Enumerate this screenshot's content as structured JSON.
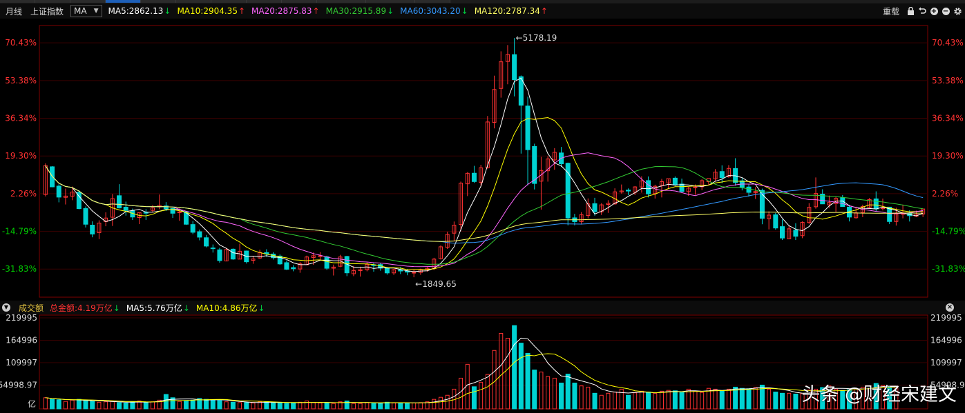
{
  "toolbar": {
    "period": "月线",
    "index_name": "上证指数",
    "indicator": "MA",
    "ma_items": [
      {
        "label": "MA5:2862.13",
        "dir": "down",
        "color": "#ffffff"
      },
      {
        "label": "MA10:2904.35",
        "dir": "up",
        "color": "#ffff00"
      },
      {
        "label": "MA20:2875.83",
        "dir": "up",
        "color": "#ff66ff"
      },
      {
        "label": "MA30:2915.89",
        "dir": "down",
        "color": "#33cc33"
      },
      {
        "label": "MA60:3043.20",
        "dir": "down",
        "color": "#3399ff"
      },
      {
        "label": "MA120:2787.34",
        "dir": "up",
        "color": "#ffff66"
      }
    ],
    "reload_label": "重载"
  },
  "volume_bar": {
    "title": "成交额",
    "total": "总金额:4.19万亿",
    "total_dir": "down",
    "ma5": "MA5:5.76万亿",
    "ma5_dir": "down",
    "ma10": "MA10:4.86万亿",
    "ma10_dir": "down"
  },
  "watermark": "头条 @财经宋建文",
  "colors": {
    "up": "#ff3232",
    "down": "#00d2d2",
    "grid": "#3a0000",
    "axis": "#800000",
    "pos_label": "#ff3232",
    "neg_label": "#00cc00"
  },
  "chart_data": [
    {
      "type": "candlestick",
      "y_axis_percent_labels": [
        "70.43%",
        "53.38%",
        "36.34%",
        "19.30%",
        "2.26%",
        "-14.79%",
        "-31.83%"
      ],
      "annotations": [
        {
          "text": "←5178.19",
          "target": "max"
        },
        {
          "text": "←1849.65",
          "target": "min"
        }
      ],
      "base_price": 3000,
      "ylim": [
        1664,
        5348
      ],
      "ohlc": [
        [
          3056,
          3478,
          3030,
          3447
        ],
        [
          3432,
          3441,
          3154,
          3160
        ],
        [
          3170,
          3195,
          2950,
          3021
        ],
        [
          3018,
          3137,
          2921,
          3035
        ],
        [
          3034,
          3164,
          2979,
          3090
        ],
        [
          3087,
          3115,
          2855,
          2865
        ],
        [
          2866,
          2895,
          2609,
          2653
        ],
        [
          2641,
          2692,
          2476,
          2520
        ],
        [
          2539,
          2706,
          2452,
          2669
        ],
        [
          2689,
          2815,
          2626,
          2737
        ],
        [
          2748,
          3062,
          2630,
          3000
        ],
        [
          3040,
          3196,
          2868,
          2874
        ],
        [
          2884,
          2960,
          2770,
          2840
        ],
        [
          2835,
          2865,
          2711,
          2751
        ],
        [
          2744,
          2804,
          2655,
          2809
        ],
        [
          2812,
          2858,
          2712,
          2809
        ],
        [
          2841,
          2915,
          2814,
          2874
        ],
        [
          2887,
          3056,
          2856,
          2908
        ],
        [
          2901,
          2953,
          2832,
          2863
        ],
        [
          2867,
          2874,
          2739,
          2802
        ],
        [
          2813,
          2868,
          2700,
          2820
        ],
        [
          2823,
          2830,
          2644,
          2653
        ],
        [
          2649,
          2696,
          2518,
          2544
        ],
        [
          2552,
          2581,
          2435,
          2478
        ],
        [
          2470,
          2508,
          2339,
          2357
        ],
        [
          2331,
          2379,
          2269,
          2324
        ],
        [
          2306,
          2333,
          2132,
          2160
        ],
        [
          2155,
          2325,
          2149,
          2310
        ],
        [
          2315,
          2325,
          2171,
          2181
        ],
        [
          2180,
          2389,
          2178,
          2287
        ],
        [
          2290,
          2296,
          2120,
          2144
        ],
        [
          2164,
          2219,
          2117,
          2182
        ],
        [
          2195,
          2308,
          2183,
          2269
        ],
        [
          2269,
          2314,
          2209,
          2250
        ],
        [
          2249,
          2274,
          2174,
          2199
        ],
        [
          2221,
          2243,
          2102,
          2115
        ],
        [
          2132,
          2164,
          2032,
          2042
        ],
        [
          2065,
          2099,
          2015,
          2049
        ],
        [
          2046,
          2140,
          1995,
          2116
        ],
        [
          2104,
          2227,
          2098,
          2209
        ],
        [
          2201,
          2270,
          2103,
          2226
        ],
        [
          2225,
          2275,
          2158,
          2225
        ],
        [
          2211,
          2226,
          2034,
          2056
        ],
        [
          2057,
          2106,
          1958,
          2072
        ],
        [
          2083,
          2238,
          2071,
          2209
        ],
        [
          2216,
          2225,
          1949,
          1994
        ],
        [
          1982,
          2088,
          1949,
          2025
        ],
        [
          2023,
          2077,
          1943,
          2035
        ],
        [
          2036,
          2142,
          2015,
          2109
        ],
        [
          2102,
          2132,
          2010,
          2100
        ],
        [
          2106,
          2124,
          2023,
          2058
        ],
        [
          2060,
          2074,
          1969,
          1993
        ],
        [
          1993,
          2048,
          1965,
          2036
        ],
        [
          2035,
          2072,
          1977,
          2019
        ],
        [
          2017,
          2048,
          1961,
          2004
        ],
        [
          1993,
          2037,
          1934,
          2000
        ],
        [
          1999,
          2051,
          1967,
          2034
        ],
        [
          2034,
          2072,
          2009,
          2055
        ],
        [
          2054,
          2198,
          2032,
          2180
        ],
        [
          2186,
          2366,
          2175,
          2347
        ],
        [
          2340,
          2551,
          2318,
          2514
        ],
        [
          2532,
          2690,
          2425,
          2640
        ],
        [
          2649,
          3231,
          2561,
          3210
        ],
        [
          3201,
          3360,
          3035,
          3344
        ],
        [
          3345,
          3445,
          3214,
          3232
        ],
        [
          3222,
          3459,
          3176,
          3418
        ],
        [
          3419,
          4121,
          3406,
          4040
        ],
        [
          4035,
          4668,
          3953,
          4480
        ],
        [
          4495,
          4998,
          4370,
          4856
        ],
        [
          4860,
          5083,
          4551,
          4955
        ],
        [
          4953,
          5178,
          4387,
          4613
        ],
        [
          4654,
          4671,
          3611,
          4267
        ],
        [
          4256,
          4384,
          3180,
          3664
        ],
        [
          3708,
          3745,
          3125,
          3206
        ],
        [
          3237,
          3567,
          2851,
          3382
        ],
        [
          3378,
          3577,
          3231,
          3538
        ],
        [
          3525,
          3685,
          3392,
          3628
        ],
        [
          3620,
          3701,
          3429,
          3473
        ],
        [
          3480,
          3489,
          2638,
          2738
        ],
        [
          2740,
          2794,
          2638,
          2688
        ],
        [
          2688,
          2817,
          2649,
          2781
        ],
        [
          2771,
          3003,
          2734,
          2929
        ],
        [
          2932,
          3012,
          2770,
          2822
        ],
        [
          2821,
          2939,
          2779,
          2916
        ],
        [
          2922,
          2979,
          2807,
          2938
        ],
        [
          2929,
          3140,
          2917,
          3092
        ],
        [
          3090,
          3192,
          3069,
          3104
        ],
        [
          3116,
          3139,
          3048,
          3103
        ],
        [
          3087,
          3170,
          3049,
          3159
        ],
        [
          3158,
          3303,
          3081,
          3241
        ],
        [
          3245,
          3301,
          3016,
          3064
        ],
        [
          3070,
          3189,
          3002,
          3168
        ],
        [
          3176,
          3268,
          3017,
          3230
        ],
        [
          3213,
          3263,
          3134,
          3272
        ],
        [
          3278,
          3301,
          3174,
          3186
        ],
        [
          3198,
          3272,
          3086,
          3098
        ],
        [
          3095,
          3160,
          3038,
          3143
        ],
        [
          3149,
          3192,
          3053,
          3159
        ],
        [
          3161,
          3264,
          3115,
          3244
        ],
        [
          3230,
          3240,
          3185,
          3274
        ],
        [
          3268,
          3400,
          3235,
          3360
        ],
        [
          3368,
          3452,
          3211,
          3285
        ],
        [
          3297,
          3455,
          3284,
          3410
        ],
        [
          3408,
          3548,
          3175,
          3218
        ],
        [
          3242,
          3278,
          3112,
          3155
        ],
        [
          3158,
          3192,
          3027,
          3085
        ],
        [
          3080,
          3156,
          2996,
          3098
        ],
        [
          3112,
          3136,
          2653,
          2733
        ],
        [
          2728,
          2827,
          2583,
          2777
        ],
        [
          2781,
          2807,
          2580,
          2602
        ],
        [
          2621,
          2718,
          2440,
          2466
        ],
        [
          2455,
          2628,
          2450,
          2591
        ],
        [
          2571,
          2667,
          2440,
          2490
        ],
        [
          2498,
          2692,
          2464,
          2679
        ],
        [
          2676,
          2939,
          2659,
          2882
        ],
        [
          2890,
          3288,
          2864,
          3070
        ],
        [
          3062,
          3127,
          2935,
          2929
        ],
        [
          2916,
          3042,
          2876,
          2947
        ],
        [
          2934,
          3029,
          2820,
          3003
        ],
        [
          3011,
          3049,
          2939,
          2893
        ],
        [
          2885,
          2917,
          2691,
          2750
        ],
        [
          2741,
          2891,
          2730,
          2807
        ],
        [
          2810,
          2918,
          2749,
          2892
        ],
        [
          2879,
          3008,
          2866,
          2988
        ],
        [
          2997,
          3099,
          2822,
          2861
        ],
        [
          2864,
          3001,
          2840,
          2877
        ],
        [
          2885,
          2886,
          2656,
          2690
        ],
        [
          2690,
          2878,
          2635,
          2792
        ],
        [
          2796,
          2919,
          2733,
          2798
        ],
        [
          2800,
          2842,
          2690,
          2769
        ],
        [
          2761,
          2837,
          2750,
          2786
        ],
        [
          2791,
          2863,
          2751,
          2860
        ]
      ],
      "ma_series": [
        {
          "name": "MA5",
          "color": "#ffffff"
        },
        {
          "name": "MA10",
          "color": "#ffff00"
        },
        {
          "name": "MA20",
          "color": "#ff66ff"
        },
        {
          "name": "MA30",
          "color": "#33cc33"
        },
        {
          "name": "MA60",
          "color": "#3399ff"
        },
        {
          "name": "MA120",
          "color": "#ffff66"
        }
      ]
    },
    {
      "type": "bar",
      "y_axis_labels": [
        "219995",
        "164996",
        "109997",
        "54998.97"
      ],
      "y_unit": "亿",
      "ylim": [
        0,
        219995
      ],
      "values": [
        24000,
        20000,
        19000,
        15000,
        18000,
        20000,
        16000,
        15000,
        13000,
        14000,
        15000,
        12000,
        11000,
        14000,
        16000,
        13000,
        14000,
        18000,
        32000,
        24000,
        15000,
        16000,
        18000,
        22000,
        20000,
        18000,
        17000,
        14000,
        13000,
        12000,
        12000,
        11000,
        14000,
        14000,
        12000,
        12000,
        10000,
        11000,
        13000,
        16000,
        12000,
        11000,
        11000,
        10000,
        14000,
        16000,
        10000,
        10000,
        12000,
        11000,
        11000,
        13000,
        11000,
        11000,
        11000,
        11000,
        12000,
        14000,
        20000,
        25000,
        30000,
        45000,
        72000,
        106000,
        51000,
        62000,
        81000,
        140000,
        182000,
        170000,
        201000,
        158000,
        133000,
        92000,
        87000,
        76000,
        72000,
        60000,
        82000,
        60000,
        53000,
        50000,
        35000,
        30000,
        35000,
        38000,
        45000,
        30000,
        36000,
        40000,
        38000,
        35000,
        40000,
        42000,
        41000,
        37000,
        45000,
        40000,
        37000,
        47000,
        45000,
        41000,
        45000,
        50000,
        47000,
        46000,
        49000,
        55000,
        45000,
        38000,
        35000,
        35000,
        33000,
        34000,
        43000,
        45000,
        49000,
        53000,
        45000,
        42000,
        44000,
        47000,
        50000,
        47000,
        59000,
        54000,
        52000,
        51000
      ],
      "ma_series": [
        {
          "name": "MA5",
          "color": "#ffffff"
        },
        {
          "name": "MA10",
          "color": "#ffff00"
        }
      ]
    }
  ]
}
